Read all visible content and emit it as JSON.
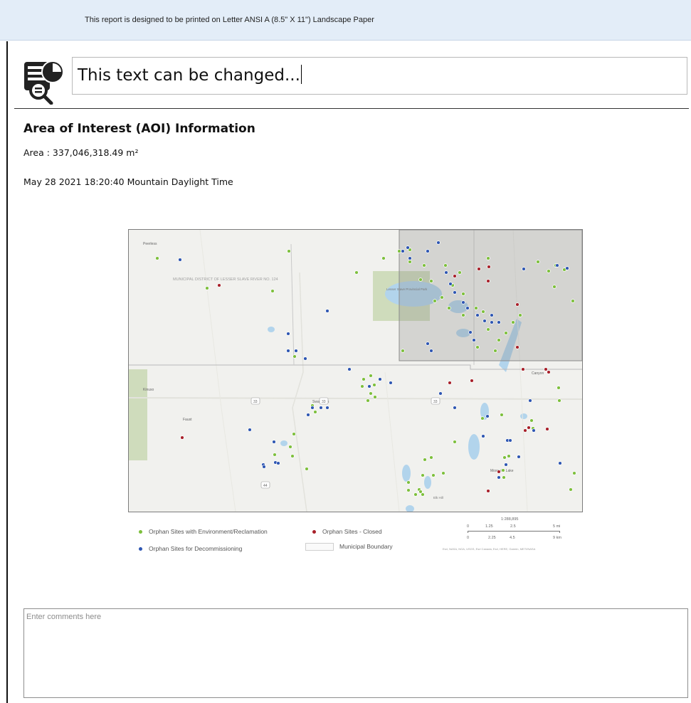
{
  "banner": {
    "text": "This report is designed to be printed on Letter ANSI A (8.5\" X 11\") Landscape Paper"
  },
  "header": {
    "icon": "report-icon",
    "title_text": "This text can be changed..."
  },
  "aoi": {
    "heading": "Area of Interest (AOI) Information",
    "area": "Area : 337,046,318.49 m²",
    "datetime": "May 28 2021 18:20:40 Mountain Daylight Time"
  },
  "map": {
    "labels": {
      "place_top_left": "Peerless",
      "district": "MUNICIPAL DISTRICT OF LESSER SLAVE RIVER NO. 124",
      "park": "Lesser Slave Provincial Park",
      "place_left": "Kinuso",
      "place_left2": "Faust",
      "place_center": "Swan Hills",
      "place_right": "Canyon",
      "place_bottom_right": "Mosquito Lake",
      "place_bottom": "Elk Hill",
      "hwy_a": "33",
      "hwy_b": "44",
      "hwy_c": "33",
      "hwy_d": "33"
    },
    "colors": {
      "green": "#7dbf3c",
      "blue": "#2e56b2",
      "red": "#a8202a",
      "water": "#b2d4ec",
      "park": "#cfdcbc",
      "land": "#f1f1ee",
      "aoi_overlay": "#8a8a8a"
    }
  },
  "legend": {
    "green_label": "Orphan Sites with Environment/Reclamation",
    "blue_label": "Orphan Sites for Decommissioning",
    "red_label": "Orphan Sites - Closed",
    "boundary_label": "Municipal Boundary"
  },
  "scalebar": {
    "ratio": "1:288,895",
    "mi_ticks": [
      "0",
      "1.25",
      "2.5",
      "5 mi"
    ],
    "km_ticks": [
      "0",
      "2.25",
      "4.5",
      "9 km"
    ],
    "attribution": "Esri, NASA, NGA, USGS, Esri Canada, Esri, HERE, Garmin, METI/NASA"
  },
  "comments": {
    "placeholder": "Enter comments here"
  }
}
